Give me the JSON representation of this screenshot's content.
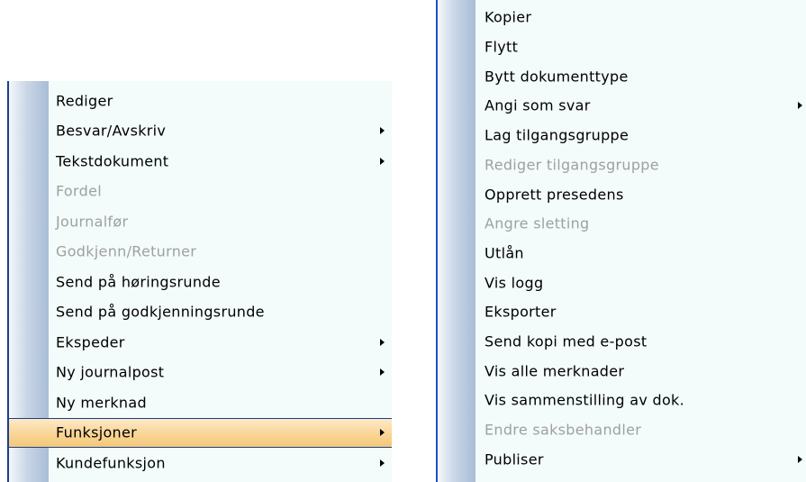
{
  "menu_left": {
    "items": [
      {
        "label": "Rediger",
        "enabled": true,
        "submenu": false
      },
      {
        "label": "Besvar/Avskriv",
        "enabled": true,
        "submenu": true
      },
      {
        "label": "Tekstdokument",
        "enabled": true,
        "submenu": true
      },
      {
        "label": "Fordel",
        "enabled": false,
        "submenu": false
      },
      {
        "label": "Journalfør",
        "enabled": false,
        "submenu": false
      },
      {
        "label": "Godkjenn/Returner",
        "enabled": false,
        "submenu": false
      },
      {
        "label": "Send på høringsrunde",
        "enabled": true,
        "submenu": false
      },
      {
        "label": "Send på godkjenningsrunde",
        "enabled": true,
        "submenu": false
      },
      {
        "label": "Ekspeder",
        "enabled": true,
        "submenu": true
      },
      {
        "label": "Ny journalpost",
        "enabled": true,
        "submenu": true
      },
      {
        "label": "Ny merknad",
        "enabled": true,
        "submenu": false
      },
      {
        "label": "Funksjoner",
        "enabled": true,
        "submenu": true,
        "selected": true
      },
      {
        "label": "Kundefunksjon",
        "enabled": true,
        "submenu": true
      }
    ]
  },
  "menu_right": {
    "items": [
      {
        "label": "Kopier",
        "enabled": true,
        "submenu": false
      },
      {
        "label": "Flytt",
        "enabled": true,
        "submenu": false
      },
      {
        "label": "Bytt dokumenttype",
        "enabled": true,
        "submenu": false
      },
      {
        "label": "Angi som svar",
        "enabled": true,
        "submenu": true
      },
      {
        "label": "Lag tilgangsgruppe",
        "enabled": true,
        "submenu": false
      },
      {
        "label": "Rediger tilgangsgruppe",
        "enabled": false,
        "submenu": false
      },
      {
        "label": "Opprett presedens",
        "enabled": true,
        "submenu": false
      },
      {
        "label": "Angre sletting",
        "enabled": false,
        "submenu": false
      },
      {
        "label": "Utlån",
        "enabled": true,
        "submenu": false
      },
      {
        "label": "Vis logg",
        "enabled": true,
        "submenu": false
      },
      {
        "label": "Eksporter",
        "enabled": true,
        "submenu": false
      },
      {
        "label": "Send kopi med e-post",
        "enabled": true,
        "submenu": false
      },
      {
        "label": "Vis alle merknader",
        "enabled": true,
        "submenu": false
      },
      {
        "label": "Vis sammenstilling av dok.",
        "enabled": true,
        "submenu": false
      },
      {
        "label": "Endre saksbehandler",
        "enabled": false,
        "submenu": false
      },
      {
        "label": "Publiser",
        "enabled": true,
        "submenu": true
      }
    ]
  },
  "colors": {
    "menu_background": "#f3fbfb",
    "disabled_text": "#a0a0a0",
    "selected_highlight": "#f9d596",
    "selected_border": "#1b3f8b"
  },
  "icons": [
    "submenu-arrow-icon"
  ]
}
